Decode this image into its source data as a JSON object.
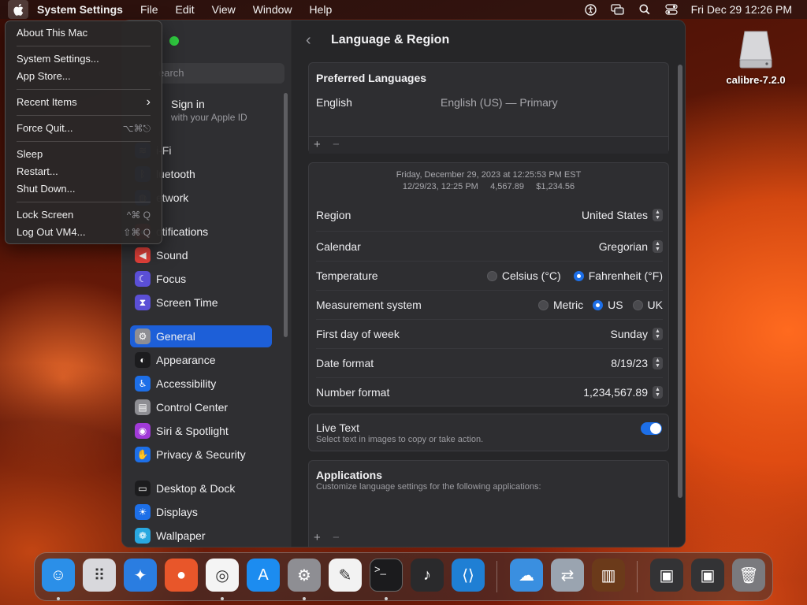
{
  "menubar": {
    "app_name": "System Settings",
    "items": [
      "File",
      "Edit",
      "View",
      "Window",
      "Help"
    ],
    "clock": "Fri Dec 29  12:26 PM",
    "icons": [
      "accessibility-icon",
      "screen-mirror-icon",
      "search-icon",
      "control-center-icon"
    ]
  },
  "apple_menu": {
    "about": "About This Mac",
    "system_settings": "System Settings...",
    "app_store": "App Store...",
    "recent_items": "Recent Items",
    "recent_arrow": "›",
    "force_quit": "Force Quit...",
    "force_quit_shortcut": "⌥⌘⎋",
    "sleep": "Sleep",
    "restart": "Restart...",
    "shut_down": "Shut Down...",
    "lock_screen": "Lock Screen",
    "lock_shortcut": "^⌘ Q",
    "log_out": "Log Out VM4...",
    "log_out_shortcut": "⇧⌘ Q"
  },
  "desktop": {
    "disk_label": "calibre-7.2.0"
  },
  "sidebar": {
    "search_placeholder": "earch",
    "signin_title": "Sign in",
    "signin_subtitle": "with your Apple ID",
    "items": [
      {
        "label": "i-Fi",
        "icon": "wifi-icon",
        "color": "#1d6fe8"
      },
      {
        "label": "luetooth",
        "icon": "bluetooth-icon",
        "color": "#1d6fe8"
      },
      {
        "label": "etwork",
        "icon": "network-icon",
        "color": "#1d6fe8"
      },
      {
        "label": "otifications",
        "icon": "notifications-icon",
        "color": "#e5413a"
      },
      {
        "label": "Sound",
        "icon": "sound-icon",
        "color": "#e5413a"
      },
      {
        "label": "Focus",
        "icon": "focus-icon",
        "color": "#5b4fd6"
      },
      {
        "label": "Screen Time",
        "icon": "screen-time-icon",
        "color": "#5b4fd6"
      },
      {
        "label": "General",
        "icon": "gear-icon",
        "color": "#8e8e93"
      },
      {
        "label": "Appearance",
        "icon": "appearance-icon",
        "color": "#1c1c1e"
      },
      {
        "label": "Accessibility",
        "icon": "accessibility-icon",
        "color": "#1d6fe8"
      },
      {
        "label": "Control Center",
        "icon": "control-center-icon",
        "color": "#8e8e93"
      },
      {
        "label": "Siri & Spotlight",
        "icon": "siri-icon",
        "color": "#a13ad8"
      },
      {
        "label": "Privacy & Security",
        "icon": "hand-icon",
        "color": "#1d6fe8"
      },
      {
        "label": "Desktop & Dock",
        "icon": "dock-icon",
        "color": "#1c1c1e"
      },
      {
        "label": "Displays",
        "icon": "displays-icon",
        "color": "#1d6fe8"
      },
      {
        "label": "Wallpaper",
        "icon": "wallpaper-icon",
        "color": "#29a8e0"
      }
    ],
    "active": "General"
  },
  "content": {
    "back": "‹",
    "title": "Language & Region",
    "preferred_languages": {
      "title": "Preferred Languages",
      "language": "English",
      "detail": "English (US) — Primary",
      "plus": "+",
      "minus": "−"
    },
    "preview": {
      "line1": "Friday, December 29, 2023 at 12:25:53 PM EST",
      "line2": "12/29/23, 12:25 PM     4,567.89     $1,234.56"
    },
    "settings": [
      {
        "label": "Region",
        "value": "United States"
      },
      {
        "label": "Calendar",
        "value": "Gregorian"
      },
      {
        "label": "First day of week",
        "value": "Sunday"
      },
      {
        "label": "Date format",
        "value": "8/19/23"
      },
      {
        "label": "Number format",
        "value": "1,234,567.89"
      }
    ],
    "temperature": {
      "label": "Temperature",
      "options": [
        "Celsius (°C)",
        "Fahrenheit (°F)"
      ],
      "selected": "Fahrenheit (°F)"
    },
    "measurement": {
      "label": "Measurement system",
      "options": [
        "Metric",
        "US",
        "UK"
      ],
      "selected": "US"
    },
    "live_text": {
      "title": "Live Text",
      "subtitle": "Select text in images to copy or take action.",
      "enabled": true
    },
    "applications": {
      "title": "Applications",
      "subtitle": "Customize language settings for the following applications:",
      "plus": "+",
      "minus": "−"
    }
  },
  "dock": {
    "apps": [
      {
        "name": "finder-icon",
        "color": "#2b8fe8"
      },
      {
        "name": "launchpad-icon",
        "color": "#d8d8dc"
      },
      {
        "name": "safari-icon",
        "color": "#2a7de1"
      },
      {
        "name": "firefox-icon",
        "color": "#e8562a"
      },
      {
        "name": "chrome-icon",
        "color": "#f4f4f4"
      },
      {
        "name": "app-store-icon",
        "color": "#1c8cf0"
      },
      {
        "name": "system-settings-icon",
        "color": "#8e8e93"
      },
      {
        "name": "textedit-icon",
        "color": "#f2f2f2"
      },
      {
        "name": "terminal-icon",
        "color": "#1b1b1d"
      },
      {
        "name": "garageband-icon",
        "color": "#2a2a2c"
      },
      {
        "name": "vscode-icon",
        "color": "#1f7fd4"
      },
      {
        "name": "weather-icon",
        "color": "#3a8fe0"
      },
      {
        "name": "migration-assistant-icon",
        "color": "#9aa4b0"
      },
      {
        "name": "calibre-icon",
        "color": "#6b3a1a"
      },
      {
        "name": "terminal-window-thumbnail-icon",
        "color": "#333335"
      },
      {
        "name": "terminal-window-thumbnail-2-icon",
        "color": "#333335"
      },
      {
        "name": "trash-icon",
        "color": "#7a7a7e"
      }
    ],
    "terminal_glyph": ">_"
  }
}
